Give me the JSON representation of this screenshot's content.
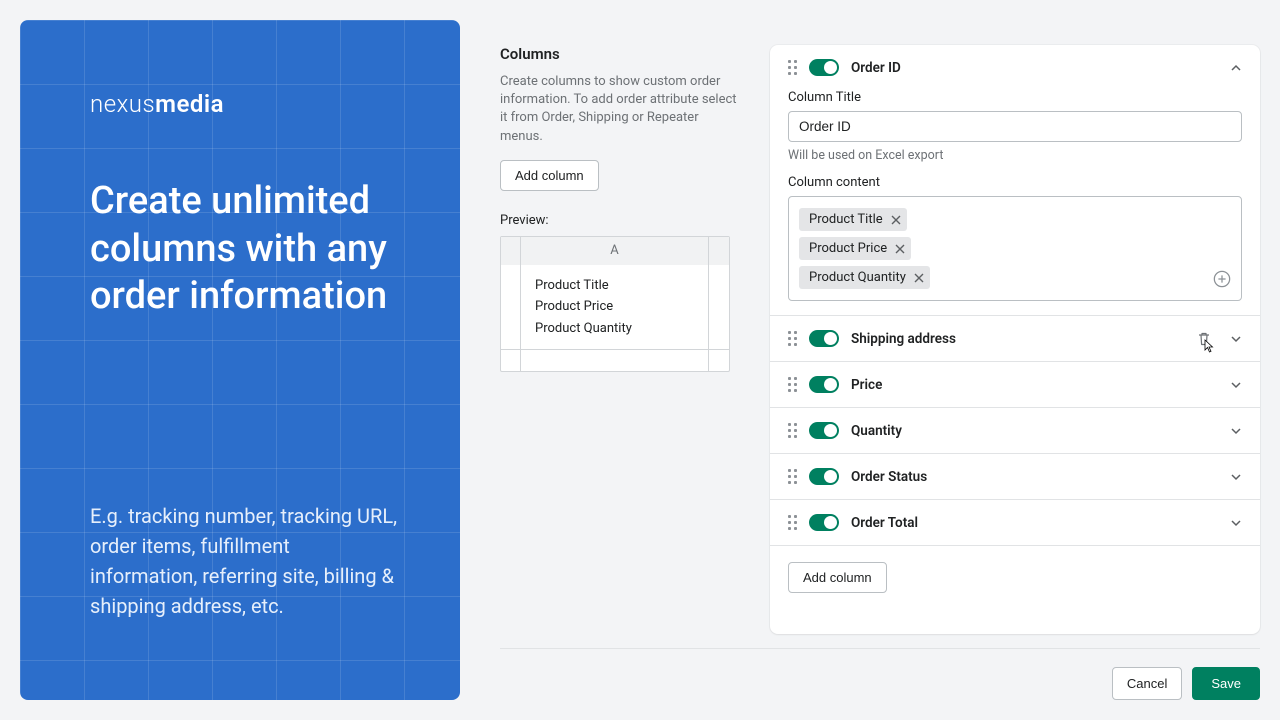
{
  "promo": {
    "logo_light": "nexus",
    "logo_bold": "media",
    "headline": "Create unlimited columns with any order information",
    "subtext": "E.g. tracking number, tracking URL, order items, fulfillment information, referring site, billing & shipping address, etc."
  },
  "columns_section": {
    "title": "Columns",
    "description": "Create columns to show custom order information. To add order attribute select it from Order, Shipping or Repeater menus.",
    "add_button": "Add column",
    "preview_label": "Preview:",
    "preview_header": "A",
    "preview_rows": [
      "Product Title",
      "Product Price",
      "Product Quantity"
    ]
  },
  "expanded_card": {
    "title": "Order ID",
    "field_column_title_label": "Column Title",
    "field_column_title_value": "Order ID",
    "field_column_title_help": "Will be used on Excel export",
    "field_content_label": "Column content",
    "tags": [
      "Product Title",
      "Product Price",
      "Product Quantity"
    ]
  },
  "cards": [
    {
      "title": "Shipping address"
    },
    {
      "title": "Price"
    },
    {
      "title": "Quantity"
    },
    {
      "title": "Order Status"
    },
    {
      "title": "Order Total"
    }
  ],
  "footer": {
    "add_column": "Add column",
    "cancel": "Cancel",
    "save": "Save"
  }
}
